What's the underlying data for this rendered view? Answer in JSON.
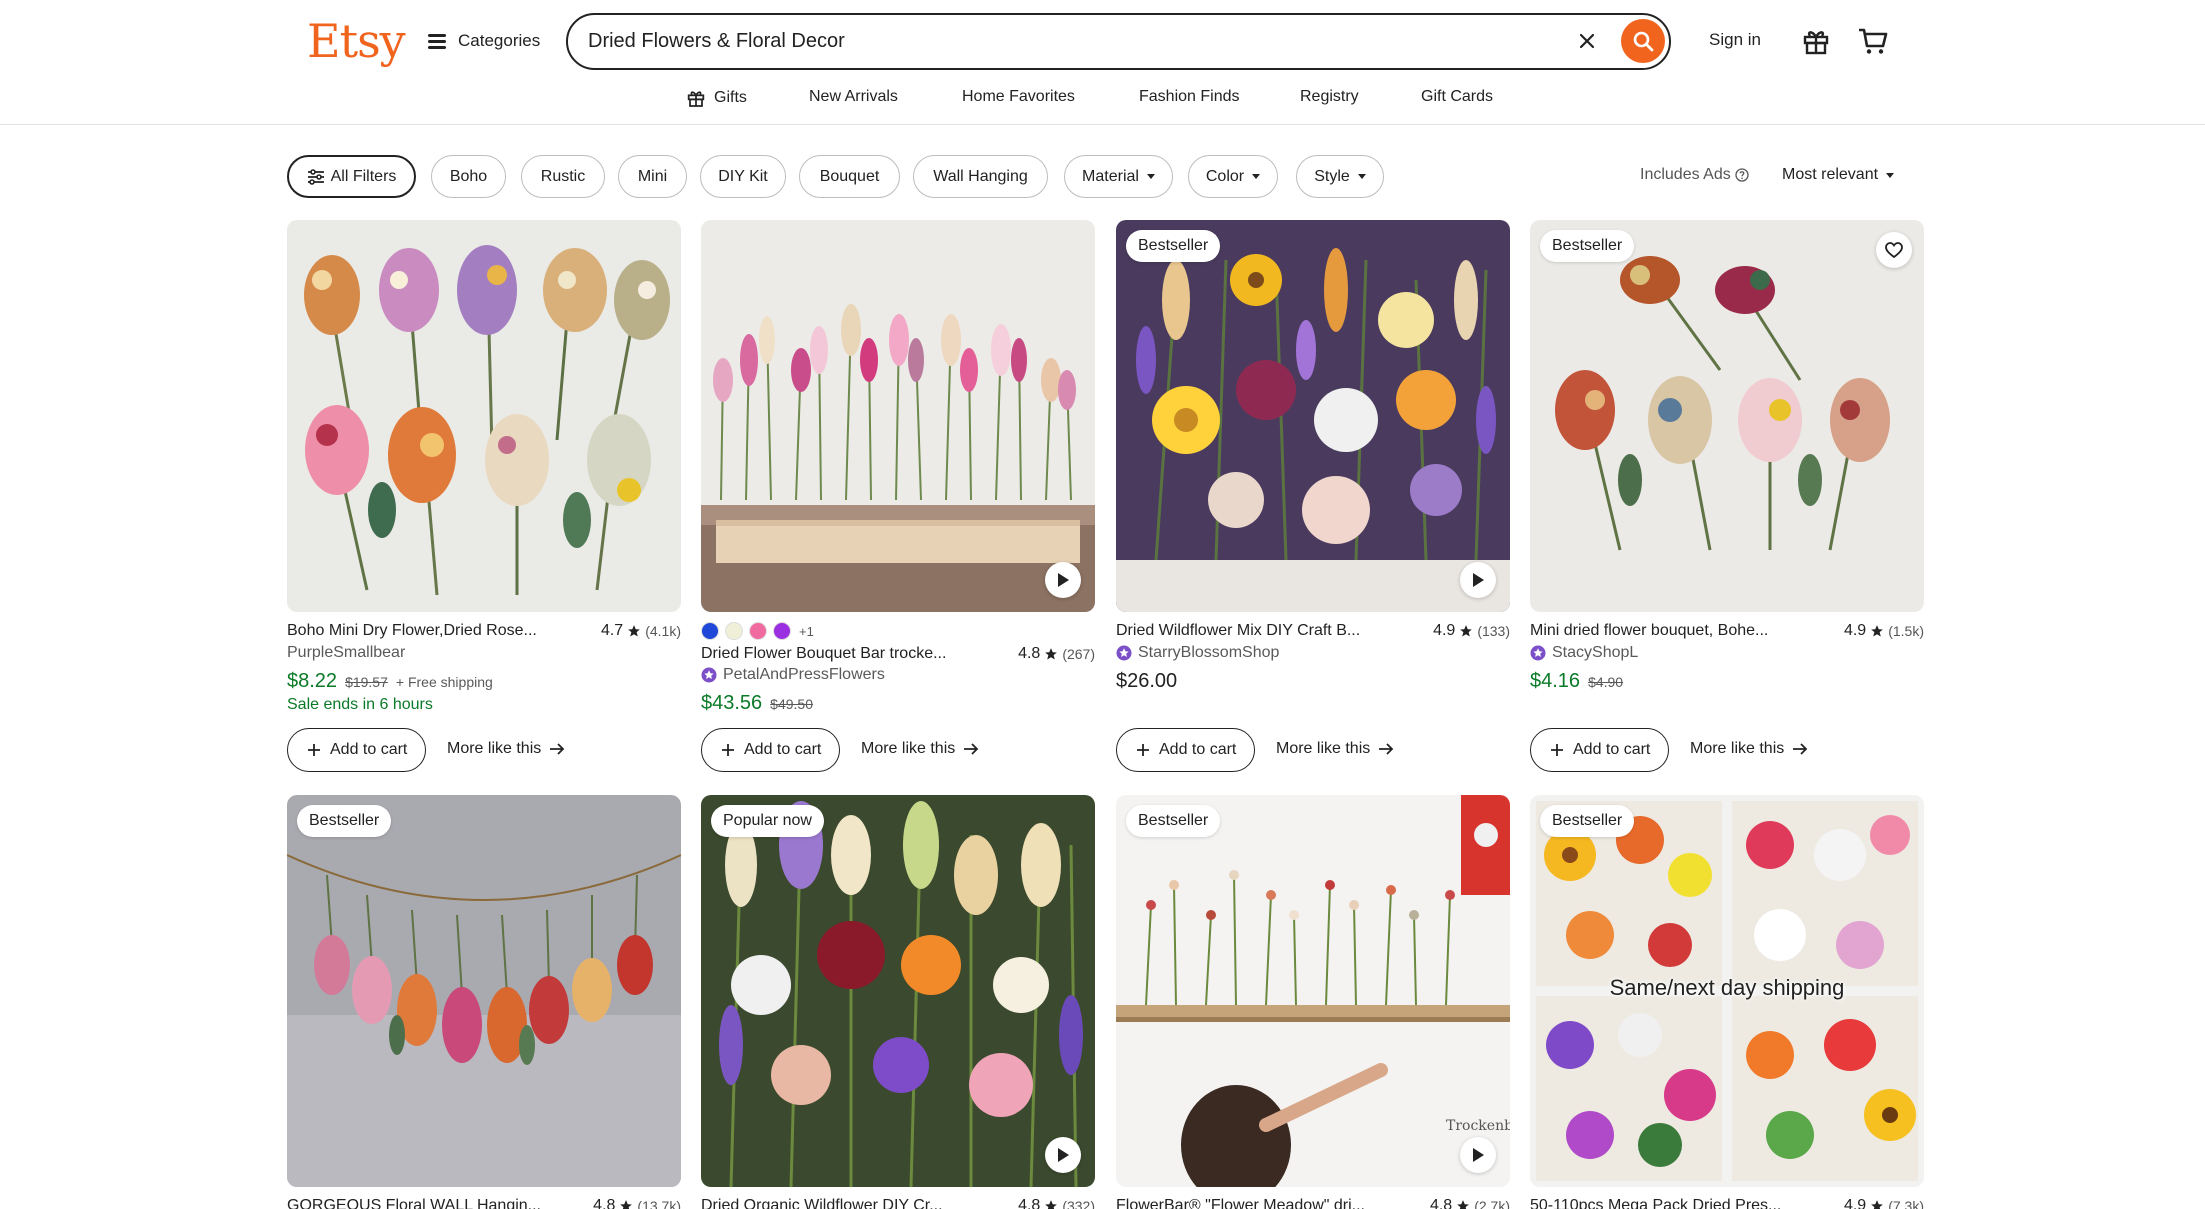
{
  "header": {
    "logo": "Etsy",
    "categories_label": "Categories",
    "search_value": "Dried Flowers & Floral Decor",
    "sign_in": "Sign in",
    "accent": "#f1641e"
  },
  "nav": [
    "Gifts",
    "New Arrivals",
    "Home Favorites",
    "Fashion Finds",
    "Registry",
    "Gift Cards"
  ],
  "filters": {
    "chips": [
      "All Filters",
      "Boho",
      "Rustic",
      "Mini",
      "DIY Kit",
      "Bouquet",
      "Wall Hanging",
      "Material",
      "Color",
      "Style"
    ],
    "ads_label": "Includes Ads",
    "sort_label": "Most relevant"
  },
  "listings": [
    {
      "title": "Boho Mini Dry Flower,Dried Rose...",
      "rating": "4.7",
      "reviews": "(4.1k)",
      "shop": "PurpleSmallbear",
      "price": "$8.22",
      "original_price": "$19.57",
      "shipping": "+ Free shipping",
      "sale_note": "Sale ends in 6 hours",
      "add_to_cart": "Add to cart",
      "more_like_this": "More like this"
    },
    {
      "title": "Dried Flower Bouquet Bar trocke...",
      "rating": "4.8",
      "reviews": "(267)",
      "shop": "PetalAndPressFlowers",
      "price": "$43.56",
      "original_price": "$49.50",
      "swatches_more": "+1",
      "swatch_colors": [
        "#2048d8",
        "#f0f0d8",
        "#f06aa0",
        "#9a2ee0"
      ],
      "add_to_cart": "Add to cart",
      "more_like_this": "More like this"
    },
    {
      "badge": "Bestseller",
      "title": "Dried Wildflower Mix DIY Craft B...",
      "rating": "4.9",
      "reviews": "(133)",
      "shop": "StarryBlossomShop",
      "price": "$26.00",
      "add_to_cart": "Add to cart",
      "more_like_this": "More like this"
    },
    {
      "badge": "Bestseller",
      "title": "Mini dried flower bouquet, Bohe...",
      "rating": "4.9",
      "reviews": "(1.5k)",
      "shop": "StacyShopL",
      "price": "$4.16",
      "original_price": "$4.90",
      "add_to_cart": "Add to cart",
      "more_like_this": "More like this"
    },
    {
      "badge": "Bestseller",
      "title": "GORGEOUS Floral WALL Hangin...",
      "rating": "4.8",
      "reviews": "(13.7k)"
    },
    {
      "badge": "Popular now",
      "title": "Dried Organic Wildflower DIY Cr...",
      "rating": "4.8",
      "reviews": "(332)"
    },
    {
      "badge": "Bestseller",
      "title": "FlowerBar® \"Flower Meadow\" dri...",
      "rating": "4.8",
      "reviews": "(2.7k)"
    },
    {
      "badge": "Bestseller",
      "title": "50-110pcs Mega Pack Dried Pres...",
      "rating": "4.9",
      "reviews": "(7.3k)",
      "image_text": "Same/next day shipping"
    }
  ]
}
